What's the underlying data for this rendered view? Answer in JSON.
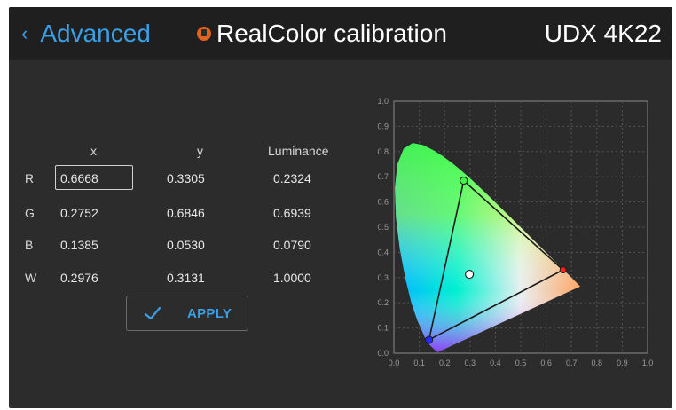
{
  "header": {
    "back_chevron": "‹",
    "back_label": "Advanced",
    "title": "RealColor calibration",
    "model": "UDX 4K22",
    "title_icon": "shield-icon",
    "accent_color": "#3aa0e6",
    "icon_color": "#e0631f"
  },
  "table": {
    "headers": {
      "x": "x",
      "y": "y",
      "luminance": "Luminance"
    },
    "rows": [
      {
        "label": "R",
        "x": "0.6668",
        "y": "0.3305",
        "luminance": "0.2324"
      },
      {
        "label": "G",
        "x": "0.2752",
        "y": "0.6846",
        "luminance": "0.6939"
      },
      {
        "label": "B",
        "x": "0.1385",
        "y": "0.0530",
        "luminance": "0.0790"
      },
      {
        "label": "W",
        "x": "0.2976",
        "y": "0.3131",
        "luminance": "1.0000"
      }
    ],
    "selected_cell": "R.x"
  },
  "apply_button": {
    "label": "APPLY",
    "icon": "check-icon"
  },
  "chart_data": {
    "type": "scatter",
    "title": "",
    "xlabel": "",
    "ylabel": "",
    "xlim": [
      0.0,
      1.0
    ],
    "ylim": [
      0.0,
      1.0
    ],
    "x_ticks": [
      "0.0",
      "0.1",
      "0.2",
      "0.3",
      "0.4",
      "0.5",
      "0.6",
      "0.7",
      "0.8",
      "0.9",
      "1.0"
    ],
    "y_ticks": [
      "0.0",
      "0.1",
      "0.2",
      "0.3",
      "0.4",
      "0.5",
      "0.6",
      "0.7",
      "0.8",
      "0.9",
      "1.0"
    ],
    "grid": true,
    "gamut_triangle": {
      "R": [
        0.6668,
        0.3305
      ],
      "G": [
        0.2752,
        0.6846
      ],
      "B": [
        0.1385,
        0.053
      ]
    },
    "white_point": [
      0.2976,
      0.3131
    ]
  }
}
